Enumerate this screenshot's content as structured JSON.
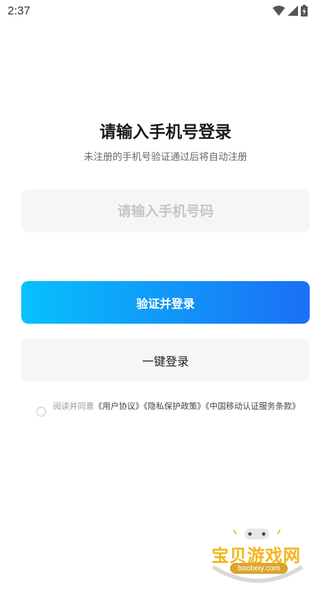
{
  "status_bar": {
    "time": "2:37",
    "icons": [
      "wifi-icon",
      "cellular-signal-icon",
      "battery-charging-icon"
    ]
  },
  "login": {
    "title": "请输入手机号登录",
    "subtitle": "未注册的手机号验证通过后将自动注册",
    "phone_placeholder": "请输入手机号码",
    "verify_button_label": "验证并登录",
    "one_click_button_label": "一键登录"
  },
  "agreement": {
    "prefix": "阅读并同意",
    "links": [
      "《用户协议》",
      "《隐私保护政策》",
      "《中国移动认证服务条款》"
    ]
  },
  "watermark": {
    "brand": "宝贝游戏网",
    "domain": "baobeiy.com"
  },
  "colors": {
    "gradient_start": "#07c1fc",
    "gradient_end": "#1a6ff5",
    "input_background": "#f6f6f6",
    "watermark": "#f2b623"
  }
}
